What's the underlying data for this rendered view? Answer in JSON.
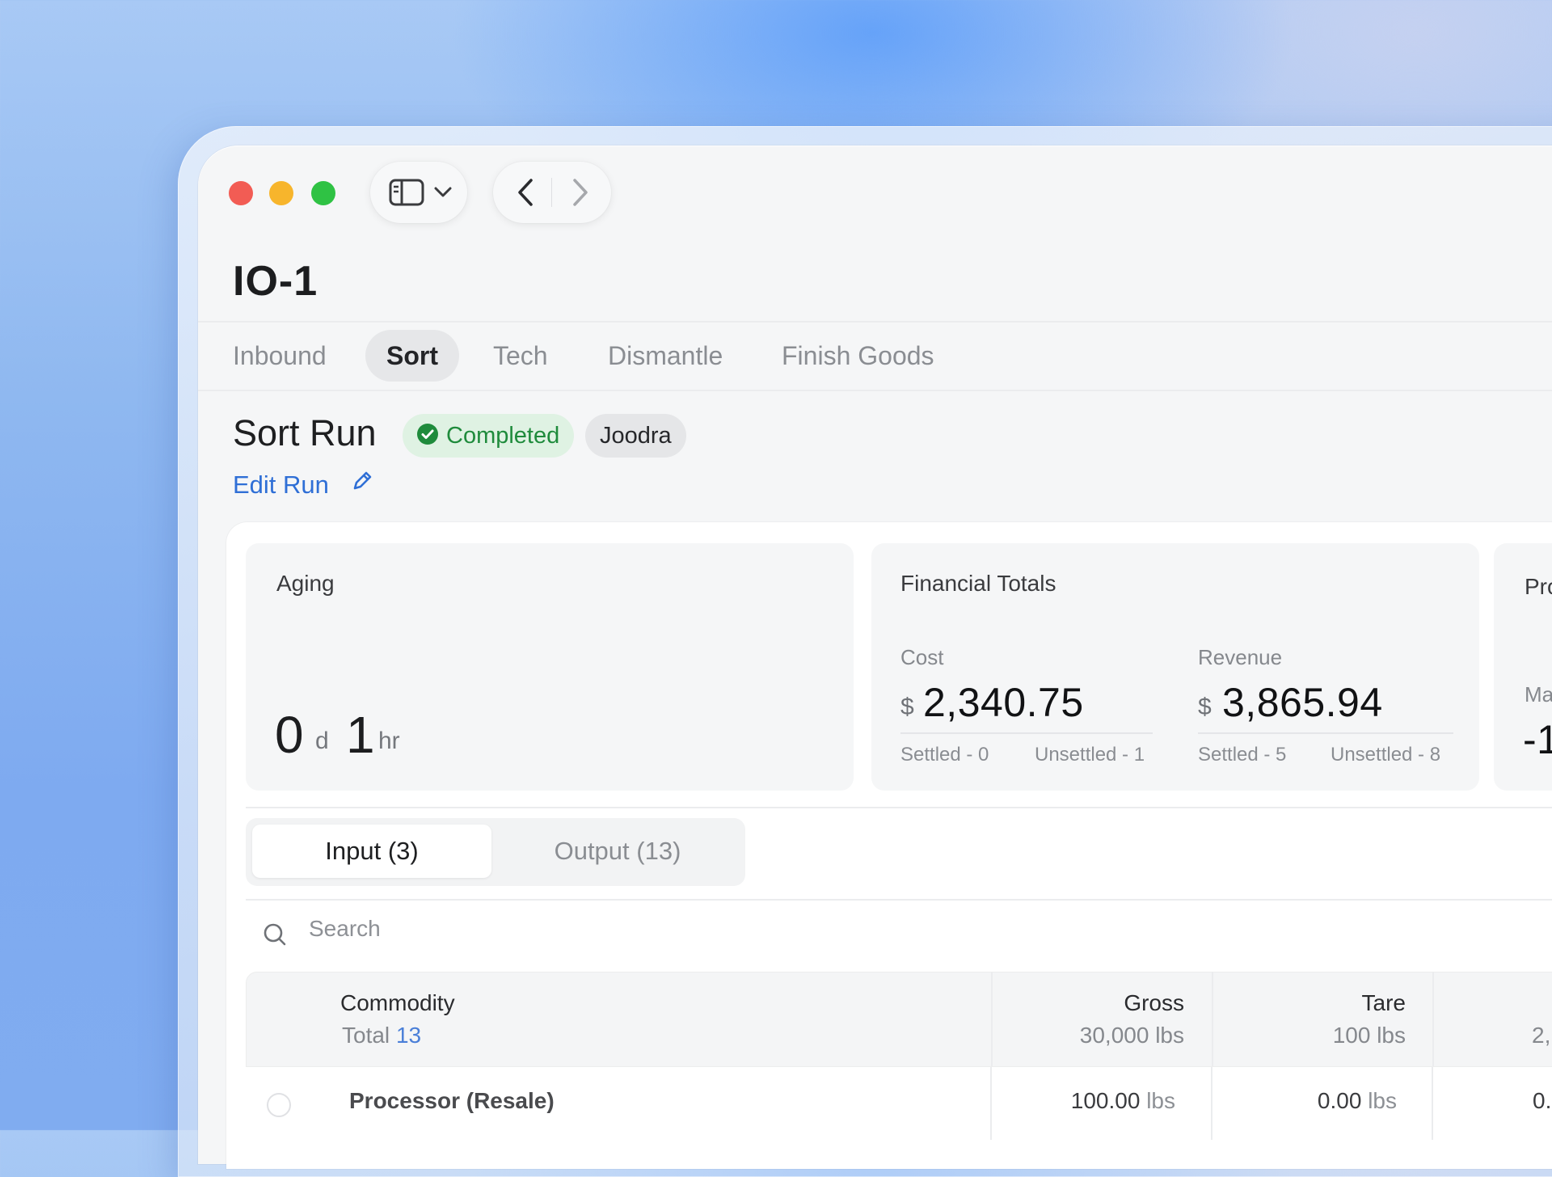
{
  "window": {
    "title": "IO-1"
  },
  "tabs": [
    {
      "label": "Inbound"
    },
    {
      "label": "Sort"
    },
    {
      "label": "Tech"
    },
    {
      "label": "Dismantle"
    },
    {
      "label": "Finish Goods"
    }
  ],
  "active_tab": "Sort",
  "run": {
    "title": "Sort Run",
    "status": "Completed",
    "assignee": "Joodra",
    "edit_label": "Edit Run"
  },
  "aging": {
    "label": "Aging",
    "days": "0",
    "days_unit": "d",
    "hours": "1",
    "hours_unit": "hr"
  },
  "financial": {
    "label": "Financial Totals",
    "cost": {
      "label": "Cost",
      "currency": "$",
      "amount": "2,340.75",
      "settled": "Settled  - 0",
      "unsettled": "Unsettled  - 1"
    },
    "revenue": {
      "label": "Revenue",
      "currency": "$",
      "amount": "3,865.94",
      "settled": "Settled  - 5",
      "unsettled": "Unsettled  - 8"
    }
  },
  "profit_card": {
    "label_partial": "Pro",
    "sub_partial": "Ma",
    "value_partial": "-1"
  },
  "segments": {
    "input": "Input (3)",
    "output": "Output (13)"
  },
  "search": {
    "placeholder": "Search"
  },
  "table": {
    "columns": {
      "commodity": {
        "title": "Commodity",
        "total_label": "Total",
        "total_value": "13"
      },
      "gross": {
        "title": "Gross",
        "value": "30,000",
        "unit": "lbs"
      },
      "tare": {
        "title": "Tare",
        "value": "100",
        "unit": "lbs"
      },
      "next_partial": {
        "value": "2,"
      }
    },
    "rows": [
      {
        "commodity": "Processor (Resale)",
        "gross": "100.00",
        "gross_unit": "lbs",
        "tare": "0.00",
        "tare_unit": "lbs",
        "next_partial": "0."
      }
    ]
  },
  "colors": {
    "accent": "#2f6fd6",
    "success": "#1f8b3c",
    "success_bg": "#dff2e3",
    "traffic_red": "#f25c54",
    "traffic_yellow": "#f7b52c",
    "traffic_green": "#2fc244"
  },
  "icons": [
    "sidebar-icon",
    "chevron-down-icon",
    "chevron-left-icon",
    "chevron-right-icon",
    "check-circle-icon",
    "pencil-icon",
    "search-icon"
  ]
}
